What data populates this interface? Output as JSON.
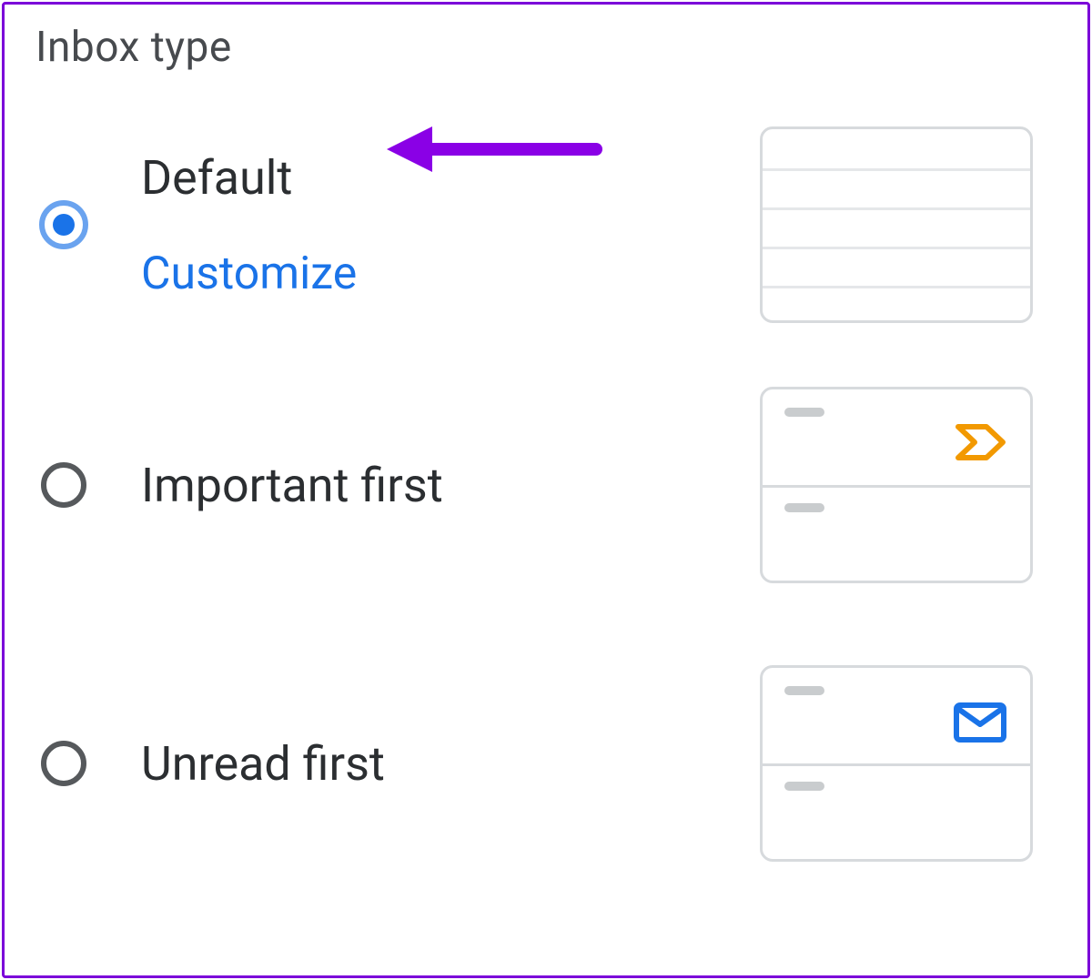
{
  "title": "Inbox type",
  "options": [
    {
      "label": "Default",
      "customize_label": "Customize",
      "selected": true
    },
    {
      "label": "Important first",
      "selected": false
    },
    {
      "label": "Unread first",
      "selected": false
    }
  ],
  "colors": {
    "accent_blue": "#1a73e8",
    "radio_blue_ring": "#6aa3ef",
    "radio_blue_dot": "#1a73e8",
    "radio_unselected": "#56595c",
    "important_marker": "#f29900",
    "unread_envelope": "#1a73e8",
    "annotation_arrow": "#8a00e6",
    "frame_border": "#7b00d9",
    "preview_border": "#d7dadd"
  }
}
